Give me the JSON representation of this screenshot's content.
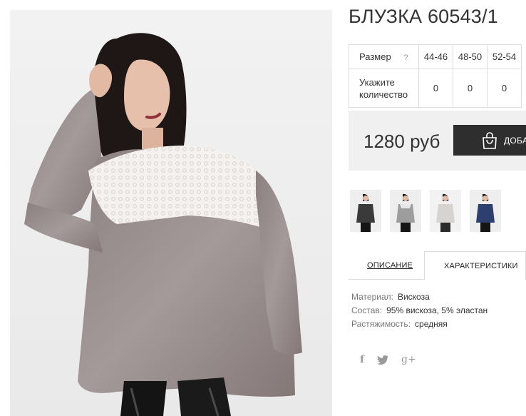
{
  "product": {
    "title": "БЛУЗКА 60543/1",
    "main_image_icon": "product-photo"
  },
  "sizes": {
    "row_label": "Размер",
    "help": "?",
    "options": [
      "44-46",
      "48-50",
      "52-54"
    ],
    "qty_label": "Укажите количество",
    "quantities": [
      "0",
      "0",
      "0"
    ]
  },
  "purchase": {
    "price": "1280 руб",
    "add_label": "ДОБАВИТЬ",
    "button_icon": "shopping-bag-icon"
  },
  "thumbnails": [
    {
      "name": "thumbnail-1",
      "color": "#3a3a3a"
    },
    {
      "name": "thumbnail-2",
      "color": "#9d9d9d"
    },
    {
      "name": "thumbnail-3",
      "color": "#d6d3d0"
    },
    {
      "name": "thumbnail-4",
      "color": "#2c3f6e"
    }
  ],
  "tabs": {
    "description": "ОПИСАНИЕ",
    "characteristics": "ХАРАКТЕРИСТИКИ",
    "active": "characteristics"
  },
  "specs": [
    {
      "key": "Материал:",
      "value": "Вискоза"
    },
    {
      "key": "Состав:",
      "value": "95% вискоза, 5% эластан"
    },
    {
      "key": "Растяжимость:",
      "value": "средняя"
    }
  ],
  "social": {
    "facebook": "f",
    "twitter_icon": "twitter-icon",
    "googleplus": "g+"
  },
  "colors": {
    "button_bg": "#2e2e2e",
    "buy_box_bg": "#f0f0f0",
    "border": "#dedede"
  }
}
